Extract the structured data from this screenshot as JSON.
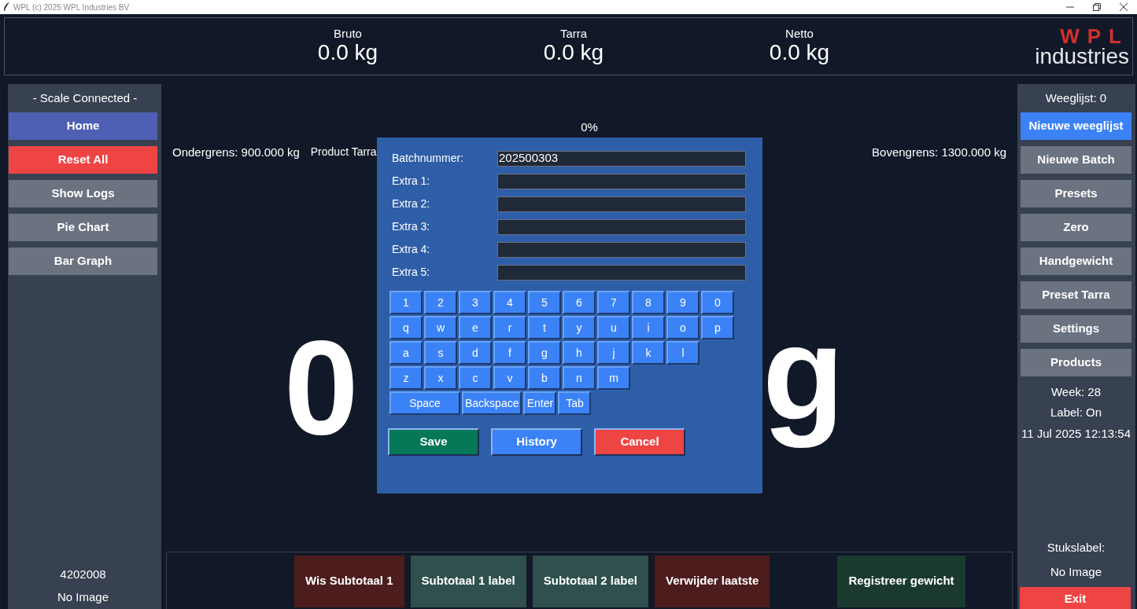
{
  "window": {
    "title": "WPL (c) 2025 WPL Industries BV"
  },
  "header": {
    "weights": [
      {
        "label": "Bruto",
        "value": "0.0 kg"
      },
      {
        "label": "Tarra",
        "value": "0.0 kg"
      },
      {
        "label": "Netto",
        "value": "0.0 kg"
      }
    ],
    "logo": {
      "mark": "WPL",
      "word": "industries"
    }
  },
  "left_sidebar": {
    "status": "- Scale Connected -",
    "buttons": [
      {
        "label": "Home",
        "kind": "home"
      },
      {
        "label": "Reset All",
        "kind": "danger"
      },
      {
        "label": "Show Logs",
        "kind": "normal"
      },
      {
        "label": "Pie Chart",
        "kind": "normal"
      },
      {
        "label": "Bar Graph",
        "kind": "normal"
      }
    ],
    "footer": [
      "4202008",
      "No Image"
    ]
  },
  "main": {
    "progress_label": "0%",
    "lower_limit": "Ondergrens: 900.000 kg",
    "product_tarra": "Product Tarra",
    "upper_limit": "Bovengrens: 1300.000 kg",
    "big_reading": {
      "left_part": "0",
      "right_part": "g"
    }
  },
  "dialog": {
    "fields": [
      {
        "label": "Batchnummer:",
        "value": "202500303"
      },
      {
        "label": "Extra 1:"
      },
      {
        "label": "Extra 2:"
      },
      {
        "label": "Extra 3:"
      },
      {
        "label": "Extra 4:"
      },
      {
        "label": "Extra 5:"
      }
    ],
    "keyboard_rows": [
      [
        "1",
        "2",
        "3",
        "4",
        "5",
        "6",
        "7",
        "8",
        "9",
        "0"
      ],
      [
        "q",
        "w",
        "e",
        "r",
        "t",
        "y",
        "u",
        "i",
        "o",
        "p"
      ],
      [
        "a",
        "s",
        "d",
        "f",
        "g",
        "h",
        "j",
        "k",
        "l"
      ],
      [
        "z",
        "x",
        "c",
        "v",
        "b",
        "n",
        "m"
      ]
    ],
    "special_keys": [
      {
        "label": "Space",
        "kind": "space"
      },
      {
        "label": "Backspace",
        "kind": "action"
      },
      {
        "label": "Enter",
        "kind": "action"
      },
      {
        "label": "Tab",
        "kind": "action"
      }
    ],
    "actions": [
      {
        "label": "Save",
        "kind": "confirm"
      },
      {
        "label": "History",
        "kind": "neutral"
      },
      {
        "label": "Cancel",
        "kind": "danger"
      }
    ]
  },
  "right_sidebar": {
    "count": "Weeglijst: 0",
    "buttons": [
      {
        "label": "Nieuwe weeglijst",
        "kind": "neutral"
      },
      {
        "label": "Nieuwe Batch",
        "kind": "normal"
      },
      {
        "label": "Presets",
        "kind": "normal"
      },
      {
        "label": "Zero",
        "kind": "normal"
      },
      {
        "label": "Handgewicht",
        "kind": "normal"
      },
      {
        "label": "Preset Tarra",
        "kind": "normal"
      },
      {
        "label": "Settings",
        "kind": "normal"
      },
      {
        "label": "Products",
        "kind": "normal"
      }
    ],
    "info": [
      "Week: 28",
      "Label: On",
      "11 Jul 2025 12:13:54"
    ],
    "stukslabel": "Stukslabel:",
    "image_status": "No Image",
    "exit": {
      "label": "Exit",
      "kind": "danger"
    }
  },
  "bottom_bar": {
    "buttons": [
      {
        "label": "Wis Subtotaal 1",
        "kind": "clear"
      },
      {
        "label": "Subtotaal 1 label",
        "kind": "print"
      },
      {
        "label": "Subtotaal 2 label",
        "kind": "print"
      },
      {
        "label": "Verwijder laatste",
        "kind": "clear"
      },
      {
        "label": "Registreer gewicht",
        "kind": "register"
      }
    ]
  }
}
